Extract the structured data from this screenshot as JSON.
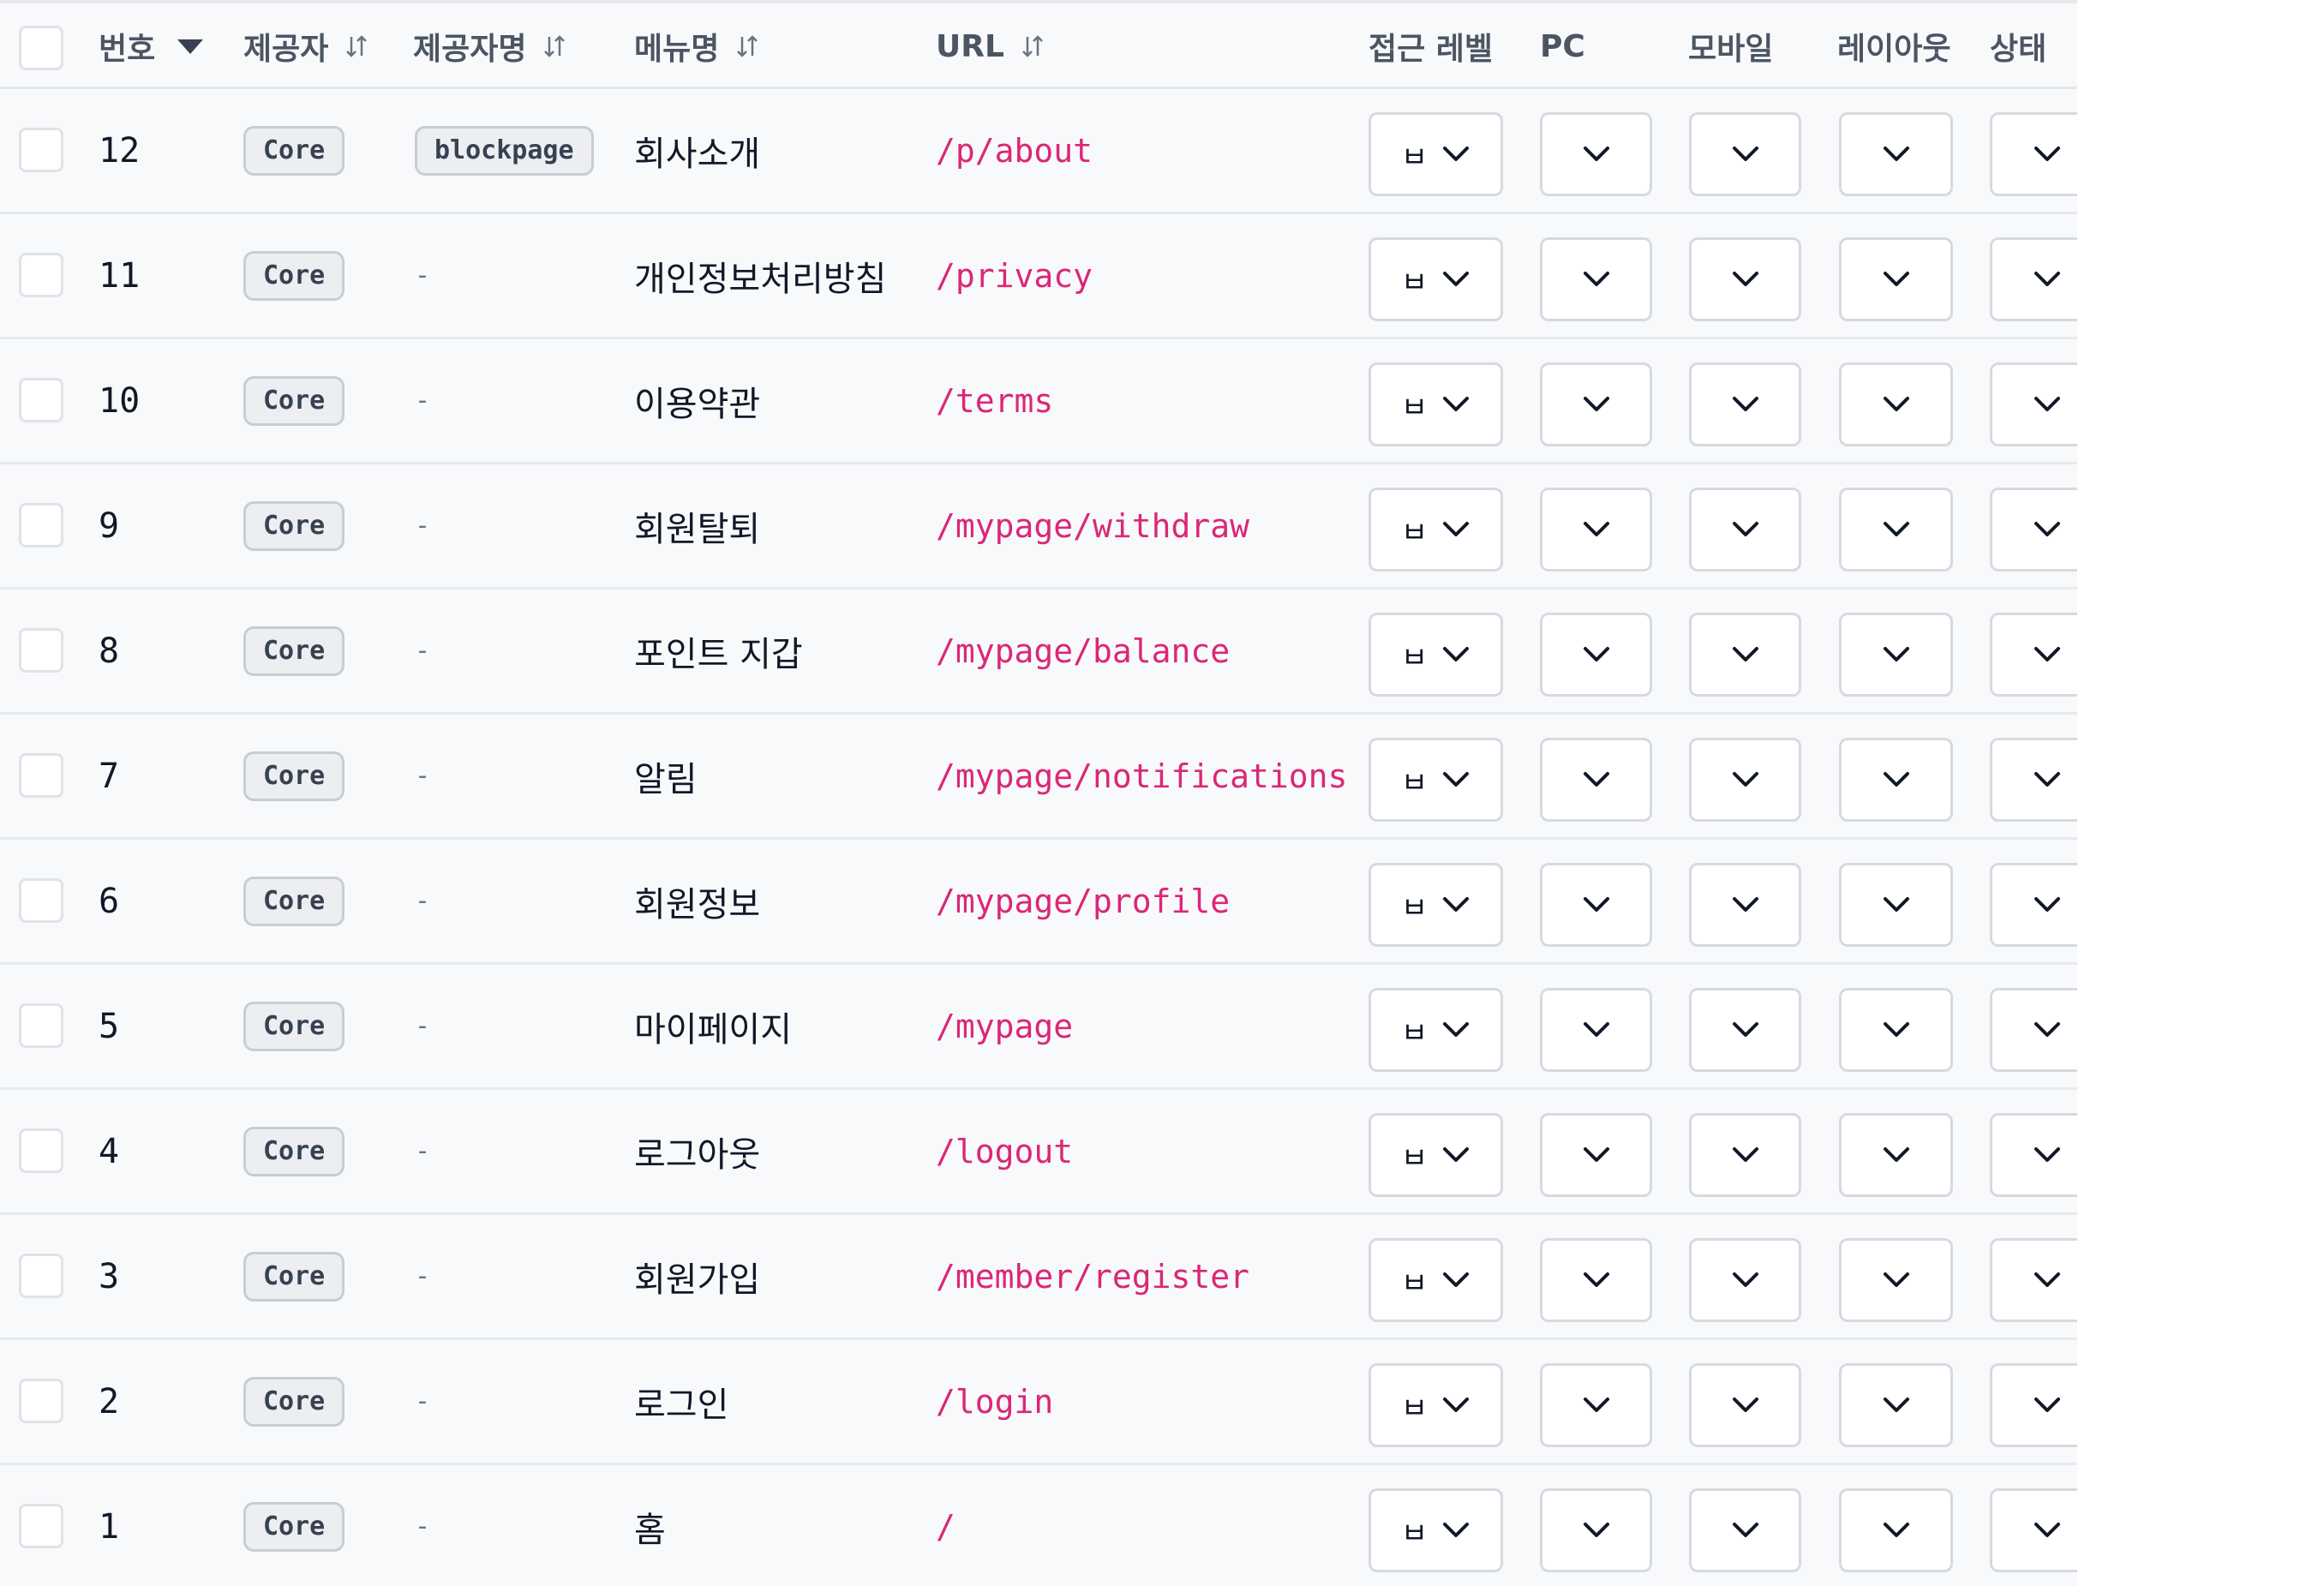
{
  "table": {
    "headers": {
      "number": "번호",
      "provider": "제공자",
      "provider_name": "제공자명",
      "menu_name": "메뉴명",
      "url": "URL",
      "access_level": "접근 레벨",
      "pc": "PC",
      "mobile": "모바일",
      "layout": "레이아웃",
      "status": "상태"
    },
    "sorted_column": "number",
    "sort_direction": "desc",
    "rows": [
      {
        "num": "12",
        "provider": "Core",
        "provider_name": "blockpage",
        "menu": "회사소개",
        "url": "/p/about",
        "access": "ㅂ"
      },
      {
        "num": "11",
        "provider": "Core",
        "provider_name": "-",
        "menu": "개인정보처리방침",
        "url": "/privacy",
        "access": "ㅂ"
      },
      {
        "num": "10",
        "provider": "Core",
        "provider_name": "-",
        "menu": "이용약관",
        "url": "/terms",
        "access": "ㅂ"
      },
      {
        "num": "9",
        "provider": "Core",
        "provider_name": "-",
        "menu": "회원탈퇴",
        "url": "/mypage/withdraw",
        "access": "ㅂ"
      },
      {
        "num": "8",
        "provider": "Core",
        "provider_name": "-",
        "menu": "포인트 지갑",
        "url": "/mypage/balance",
        "access": "ㅂ"
      },
      {
        "num": "7",
        "provider": "Core",
        "provider_name": "-",
        "menu": "알림",
        "url": "/mypage/notifications",
        "access": "ㅂ"
      },
      {
        "num": "6",
        "provider": "Core",
        "provider_name": "-",
        "menu": "회원정보",
        "url": "/mypage/profile",
        "access": "ㅂ"
      },
      {
        "num": "5",
        "provider": "Core",
        "provider_name": "-",
        "menu": "마이페이지",
        "url": "/mypage",
        "access": "ㅂ"
      },
      {
        "num": "4",
        "provider": "Core",
        "provider_name": "-",
        "menu": "로그아웃",
        "url": "/logout",
        "access": "ㅂ"
      },
      {
        "num": "3",
        "provider": "Core",
        "provider_name": "-",
        "menu": "회원가입",
        "url": "/member/register",
        "access": "ㅂ"
      },
      {
        "num": "2",
        "provider": "Core",
        "provider_name": "-",
        "menu": "로그인",
        "url": "/login",
        "access": "ㅂ"
      },
      {
        "num": "1",
        "provider": "Core",
        "provider_name": "-",
        "menu": "홈",
        "url": "/",
        "access": "ㅂ"
      }
    ]
  },
  "icons": {
    "sort_desc": "caret-down-icon",
    "sortable": "sort-arrows-icon",
    "dropdown": "chevron-down-icon"
  },
  "colors": {
    "url": "#db2777",
    "header_text": "#4b5563",
    "row_bg": "#f8f9fb"
  }
}
